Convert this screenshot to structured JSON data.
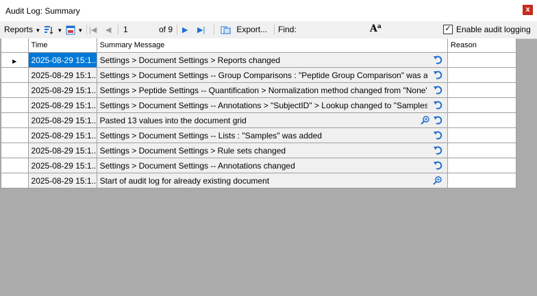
{
  "window": {
    "title": "Audit Log: Summary",
    "close_label": "x"
  },
  "toolbar": {
    "reports_label": "Reports",
    "page_input": "1",
    "page_total": "of 9",
    "export_label": "Export...",
    "find_label": "Find:",
    "enable_audit_label": "Enable audit logging",
    "enable_audit_checked": true
  },
  "grid": {
    "columns": {
      "time": "Time",
      "summary": "Summary Message",
      "reason": "Reason"
    },
    "rows": [
      {
        "time": "2025-08-29 15:1...",
        "message": "Settings > Document Settings > Reports changed",
        "icons": [
          "undo"
        ]
      },
      {
        "time": "2025-08-29 15:1...",
        "message": "Settings > Document Settings -- Group Comparisons : \"Peptide Group Comparison\" was added",
        "icons": [
          "undo"
        ]
      },
      {
        "time": "2025-08-29 15:1...",
        "message": "Settings > Peptide Settings -- Quantification > Normalization method changed from \"None\" to \"Ratio to Gl...",
        "icons": [
          "undo"
        ]
      },
      {
        "time": "2025-08-29 15:1...",
        "message": "Settings > Document Settings -- Annotations > \"SubjectID\" > Lookup changed to \"Samples\"",
        "icons": [
          "undo"
        ]
      },
      {
        "time": "2025-08-29 15:1...",
        "message": "Pasted 13 values into the document grid",
        "icons": [
          "zoom",
          "undo"
        ]
      },
      {
        "time": "2025-08-29 15:1...",
        "message": "Settings > Document Settings -- Lists : \"Samples\" was added",
        "icons": [
          "undo"
        ]
      },
      {
        "time": "2025-08-29 15:1...",
        "message": "Settings > Document Settings > Rule sets changed",
        "icons": [
          "undo"
        ]
      },
      {
        "time": "2025-08-29 15:1...",
        "message": "Settings > Document Settings -- Annotations changed",
        "icons": [
          "undo"
        ]
      },
      {
        "time": "2025-08-29 15:1...",
        "message": "Start of audit log for already existing document",
        "icons": [
          "zoom"
        ]
      }
    ]
  }
}
